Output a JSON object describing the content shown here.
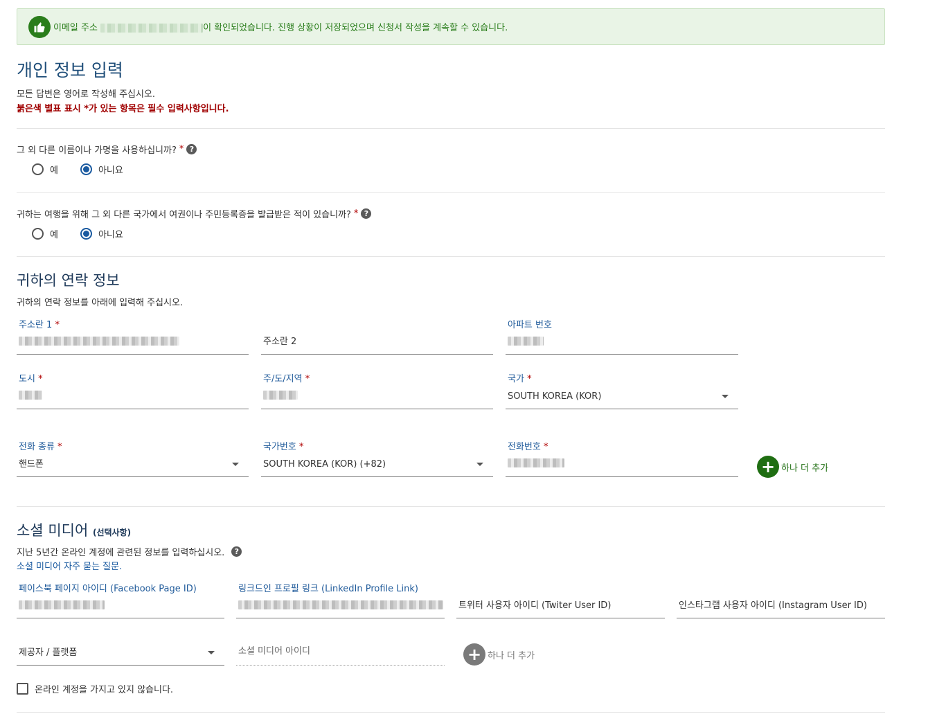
{
  "banner": {
    "message_before": "이메일 주소",
    "message_after": "이 확인되었습니다. 진행 상황이 저장되었으며 신청서 작성을 계속할 수 있습니다."
  },
  "personal": {
    "title": "개인 정보 입력",
    "instruction": "모든 답변은 영어로 작성해 주십시오.",
    "required_note": "붉은색 별표 표시 *가 있는 항목은 필수 입력사항입니다.",
    "q_other_names": "그 외 다른 이름이나 가명을 사용하십니까?",
    "q_passport": "귀하는 여행을 위해 그 외 다른 국가에서 여권이나 주민등록증을 발급받은 적이 있습니까?",
    "yes": "예",
    "no": "아니요",
    "star": "*"
  },
  "contact": {
    "title": "귀하의 연락 정보",
    "instruction": "귀하의 연락 정보를 아래에 입력해 주십시오.",
    "address1_label": "주소란 1",
    "address2_placeholder": "주소란 2",
    "apt_label": "아파트 번호",
    "city_label": "도시",
    "state_label": "주/도/지역",
    "country_label": "국가",
    "country_value": "SOUTH KOREA (KOR)",
    "phone_type_label": "전화 종류",
    "phone_type_value": "핸드폰",
    "country_code_label": "국가번호",
    "country_code_value": "SOUTH KOREA (KOR) (+82)",
    "phone_label": "전화번호",
    "add_more": "하나 더 추가"
  },
  "social": {
    "title": "소셜 미디어",
    "optional": "(선택사항)",
    "instruction": "지난 5년간 온라인 계정에 관련된 정보를 입력하십시오.",
    "faq_link": "소셜 미디어 자주 묻는 질문.",
    "facebook_label": "페이스북 페이지 아이디 (Facebook Page ID)",
    "linkedin_label": "링크드인 프로필 링크 (LinkedIn Profile Link)",
    "twitter_placeholder": "트위터 사용자 아이디 (Twiter User ID)",
    "instagram_placeholder": "인스타그램 사용자 아이디 (Instagram User ID)",
    "provider_placeholder": "제공자 / 플랫폼",
    "social_id_placeholder": "소셜 미디어 아이디",
    "add_more": "하나 더 추가",
    "no_account": "온라인 계정을 가지고 있지 않습니다."
  },
  "colors": {
    "accent": "#1f5a9a",
    "success": "#2a7d1b",
    "required": "#b00000"
  }
}
